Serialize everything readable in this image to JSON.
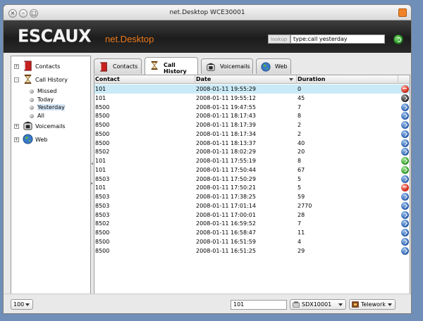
{
  "window": {
    "title": "net.Desktop WCE30001"
  },
  "banner": {
    "logo_main": "ESCAUX",
    "logo_sub": "net.Desktop",
    "lookup_label": "lookup",
    "lookup_value": "type:call yesterday"
  },
  "sidebar": {
    "contacts": "Contacts",
    "call_history": "Call History",
    "history_items": [
      "Missed",
      "Today",
      "Yesterday",
      "All"
    ],
    "selected": "Yesterday",
    "voicemails": "Voicemails",
    "web": "Web"
  },
  "tabs": [
    {
      "label": "Contacts",
      "icon": "book-icon"
    },
    {
      "label": "Call History",
      "icon": "hourglass-icon",
      "active": true
    },
    {
      "label": "Voicemails",
      "icon": "phone-icon"
    },
    {
      "label": "Web",
      "icon": "globe-icon"
    }
  ],
  "grid": {
    "columns": [
      "Contact",
      "Date",
      "Duration"
    ],
    "sort_column": "Date",
    "rows": [
      {
        "contact": "101",
        "date": "2008-01-11 19:55:29",
        "duration": "0",
        "status": "red",
        "selected": true
      },
      {
        "contact": "101",
        "date": "2008-01-11 19:55:12",
        "duration": "45",
        "status": "black"
      },
      {
        "contact": "8500",
        "date": "2008-01-11 19:47:55",
        "duration": "7",
        "status": "blue"
      },
      {
        "contact": "8500",
        "date": "2008-01-11 18:17:43",
        "duration": "8",
        "status": "blue"
      },
      {
        "contact": "8500",
        "date": "2008-01-11 18:17:39",
        "duration": "2",
        "status": "blue"
      },
      {
        "contact": "8500",
        "date": "2008-01-11 18:17:34",
        "duration": "2",
        "status": "blue"
      },
      {
        "contact": "8500",
        "date": "2008-01-11 18:13:37",
        "duration": "40",
        "status": "blue"
      },
      {
        "contact": "8502",
        "date": "2008-01-11 18:02:29",
        "duration": "20",
        "status": "blue"
      },
      {
        "contact": "101",
        "date": "2008-01-11 17:55:19",
        "duration": "8",
        "status": "green"
      },
      {
        "contact": "101",
        "date": "2008-01-11 17:50:44",
        "duration": "67",
        "status": "green"
      },
      {
        "contact": "8503",
        "date": "2008-01-11 17:50:29",
        "duration": "5",
        "status": "blue"
      },
      {
        "contact": "101",
        "date": "2008-01-11 17:50:21",
        "duration": "5",
        "status": "red"
      },
      {
        "contact": "8503",
        "date": "2008-01-11 17:38:25",
        "duration": "59",
        "status": "blue"
      },
      {
        "contact": "8503",
        "date": "2008-01-11 17:01:14",
        "duration": "2770",
        "status": "blue"
      },
      {
        "contact": "8503",
        "date": "2008-01-11 17:00:01",
        "duration": "28",
        "status": "blue"
      },
      {
        "contact": "8502",
        "date": "2008-01-11 16:59:52",
        "duration": "7",
        "status": "blue"
      },
      {
        "contact": "8500",
        "date": "2008-01-11 16:58:47",
        "duration": "11",
        "status": "blue"
      },
      {
        "contact": "8500",
        "date": "2008-01-11 16:51:59",
        "duration": "4",
        "status": "blue"
      },
      {
        "contact": "8500",
        "date": "2008-01-11 16:51:25",
        "duration": "29",
        "status": "blue"
      }
    ]
  },
  "bottombar": {
    "page_size": "100",
    "dial_value": "101",
    "line": "SDX10001",
    "status": "Telework"
  }
}
